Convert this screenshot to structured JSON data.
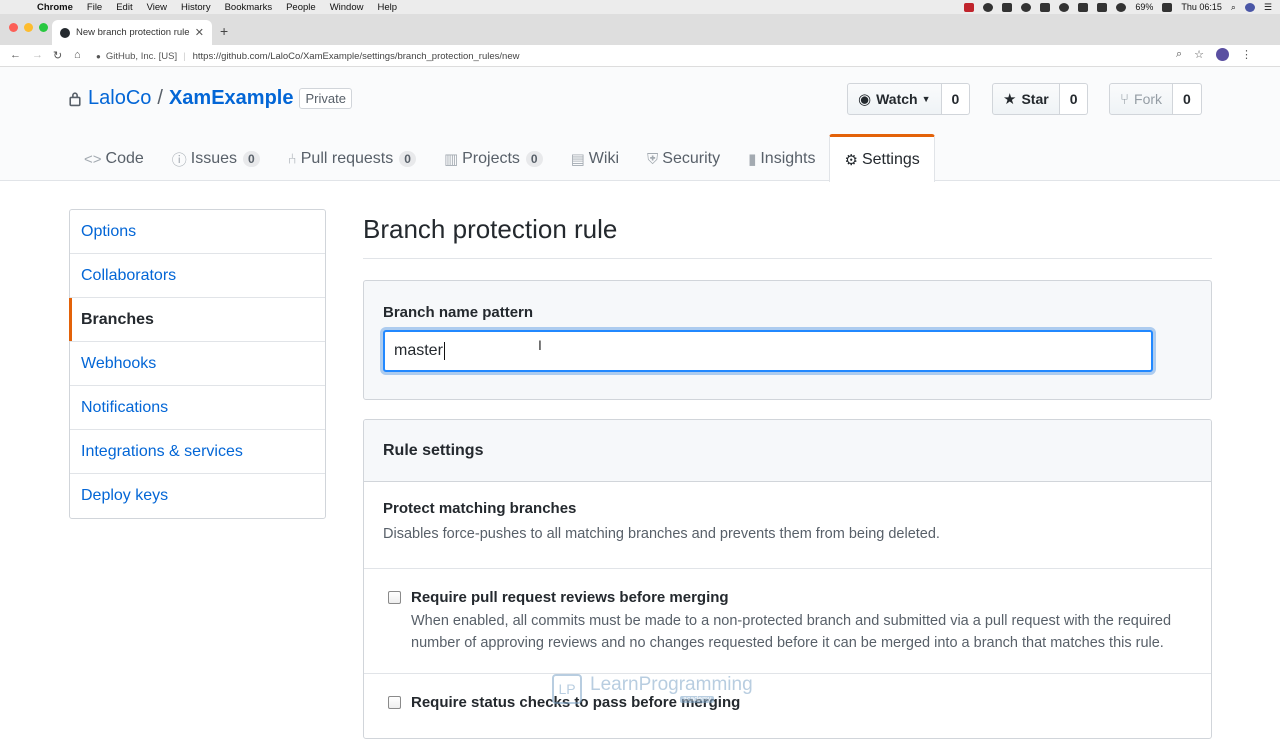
{
  "menubar": {
    "app": "Chrome",
    "items": [
      "File",
      "Edit",
      "View",
      "History",
      "Bookmarks",
      "People",
      "Window",
      "Help"
    ],
    "battery": "69%",
    "clock": "Thu 06:15"
  },
  "browser": {
    "tab_title": "New branch protection rule",
    "site_identity": "GitHub, Inc. [US]",
    "url": "https://github.com/LaloCo/XamExample/settings/branch_protection_rules/new"
  },
  "repo": {
    "owner": "LaloCo",
    "name": "XamExample",
    "visibility": "Private",
    "watch_label": "Watch",
    "watch_count": "0",
    "star_label": "Star",
    "star_count": "0",
    "fork_label": "Fork",
    "fork_count": "0"
  },
  "reponav": {
    "code": "Code",
    "issues": "Issues",
    "issues_count": "0",
    "pulls": "Pull requests",
    "pulls_count": "0",
    "projects": "Projects",
    "projects_count": "0",
    "wiki": "Wiki",
    "security": "Security",
    "insights": "Insights",
    "settings": "Settings"
  },
  "sidebar": {
    "items": [
      {
        "label": "Options"
      },
      {
        "label": "Collaborators"
      },
      {
        "label": "Branches"
      },
      {
        "label": "Webhooks"
      },
      {
        "label": "Notifications"
      },
      {
        "label": "Integrations & services"
      },
      {
        "label": "Deploy keys"
      }
    ]
  },
  "main": {
    "title": "Branch protection rule",
    "pattern_label": "Branch name pattern",
    "pattern_value": "master",
    "rule_settings": "Rule settings",
    "protect_title": "Protect matching branches",
    "protect_desc": "Disables force-pushes to all matching branches and prevents them from being deleted.",
    "opt1_title": "Require pull request reviews before merging",
    "opt1_desc": "When enabled, all commits must be made to a non-protected branch and submitted via a pull request with the required number of approving reviews and no changes requested before it can be merged into a branch that matches this rule.",
    "opt2_title": "Require status checks to pass before merging"
  },
  "watermark": {
    "mark": "LP",
    "brand": "LearnProgramming",
    "sub": "academy"
  },
  "colors": {
    "link": "#0366d6",
    "accent": "#e36209",
    "focus": "#2188ff"
  }
}
